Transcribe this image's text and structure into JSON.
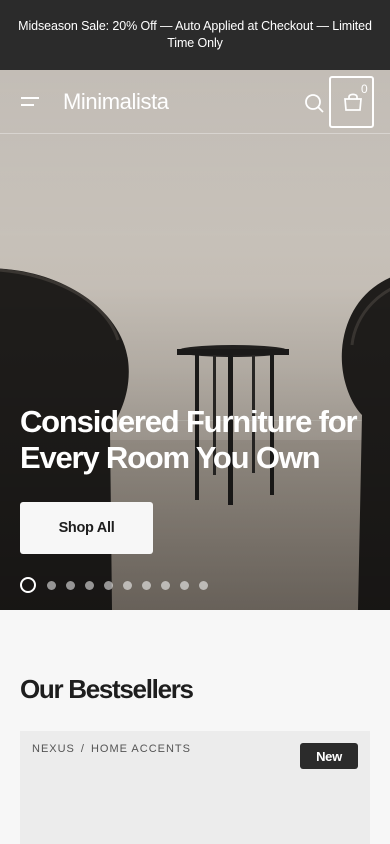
{
  "announcement": {
    "text": "Midseason Sale: 20% Off — Auto Applied at Checkout — Limited Time Only"
  },
  "header": {
    "logo": "Minimalista",
    "menu_icon": "hamburger-menu-icon",
    "search_icon": "search-icon",
    "cart_icon": "shopping-bag-icon",
    "cart_count": "0"
  },
  "hero": {
    "title": "Considered Furniture for Every Room You Own",
    "cta_label": "Shop All",
    "slide_count": 10,
    "active_slide": 1
  },
  "bestsellers": {
    "title": "Our Bestsellers",
    "card": {
      "brand": "NEXUS",
      "separator": "/",
      "category": "HOME ACCENTS",
      "badge": "New"
    }
  },
  "colors": {
    "announcement_bg": "#2b2b2b",
    "page_bg": "#f7f7f7",
    "text": "#1e1e1e",
    "badge_bg": "#2b2b2b"
  }
}
